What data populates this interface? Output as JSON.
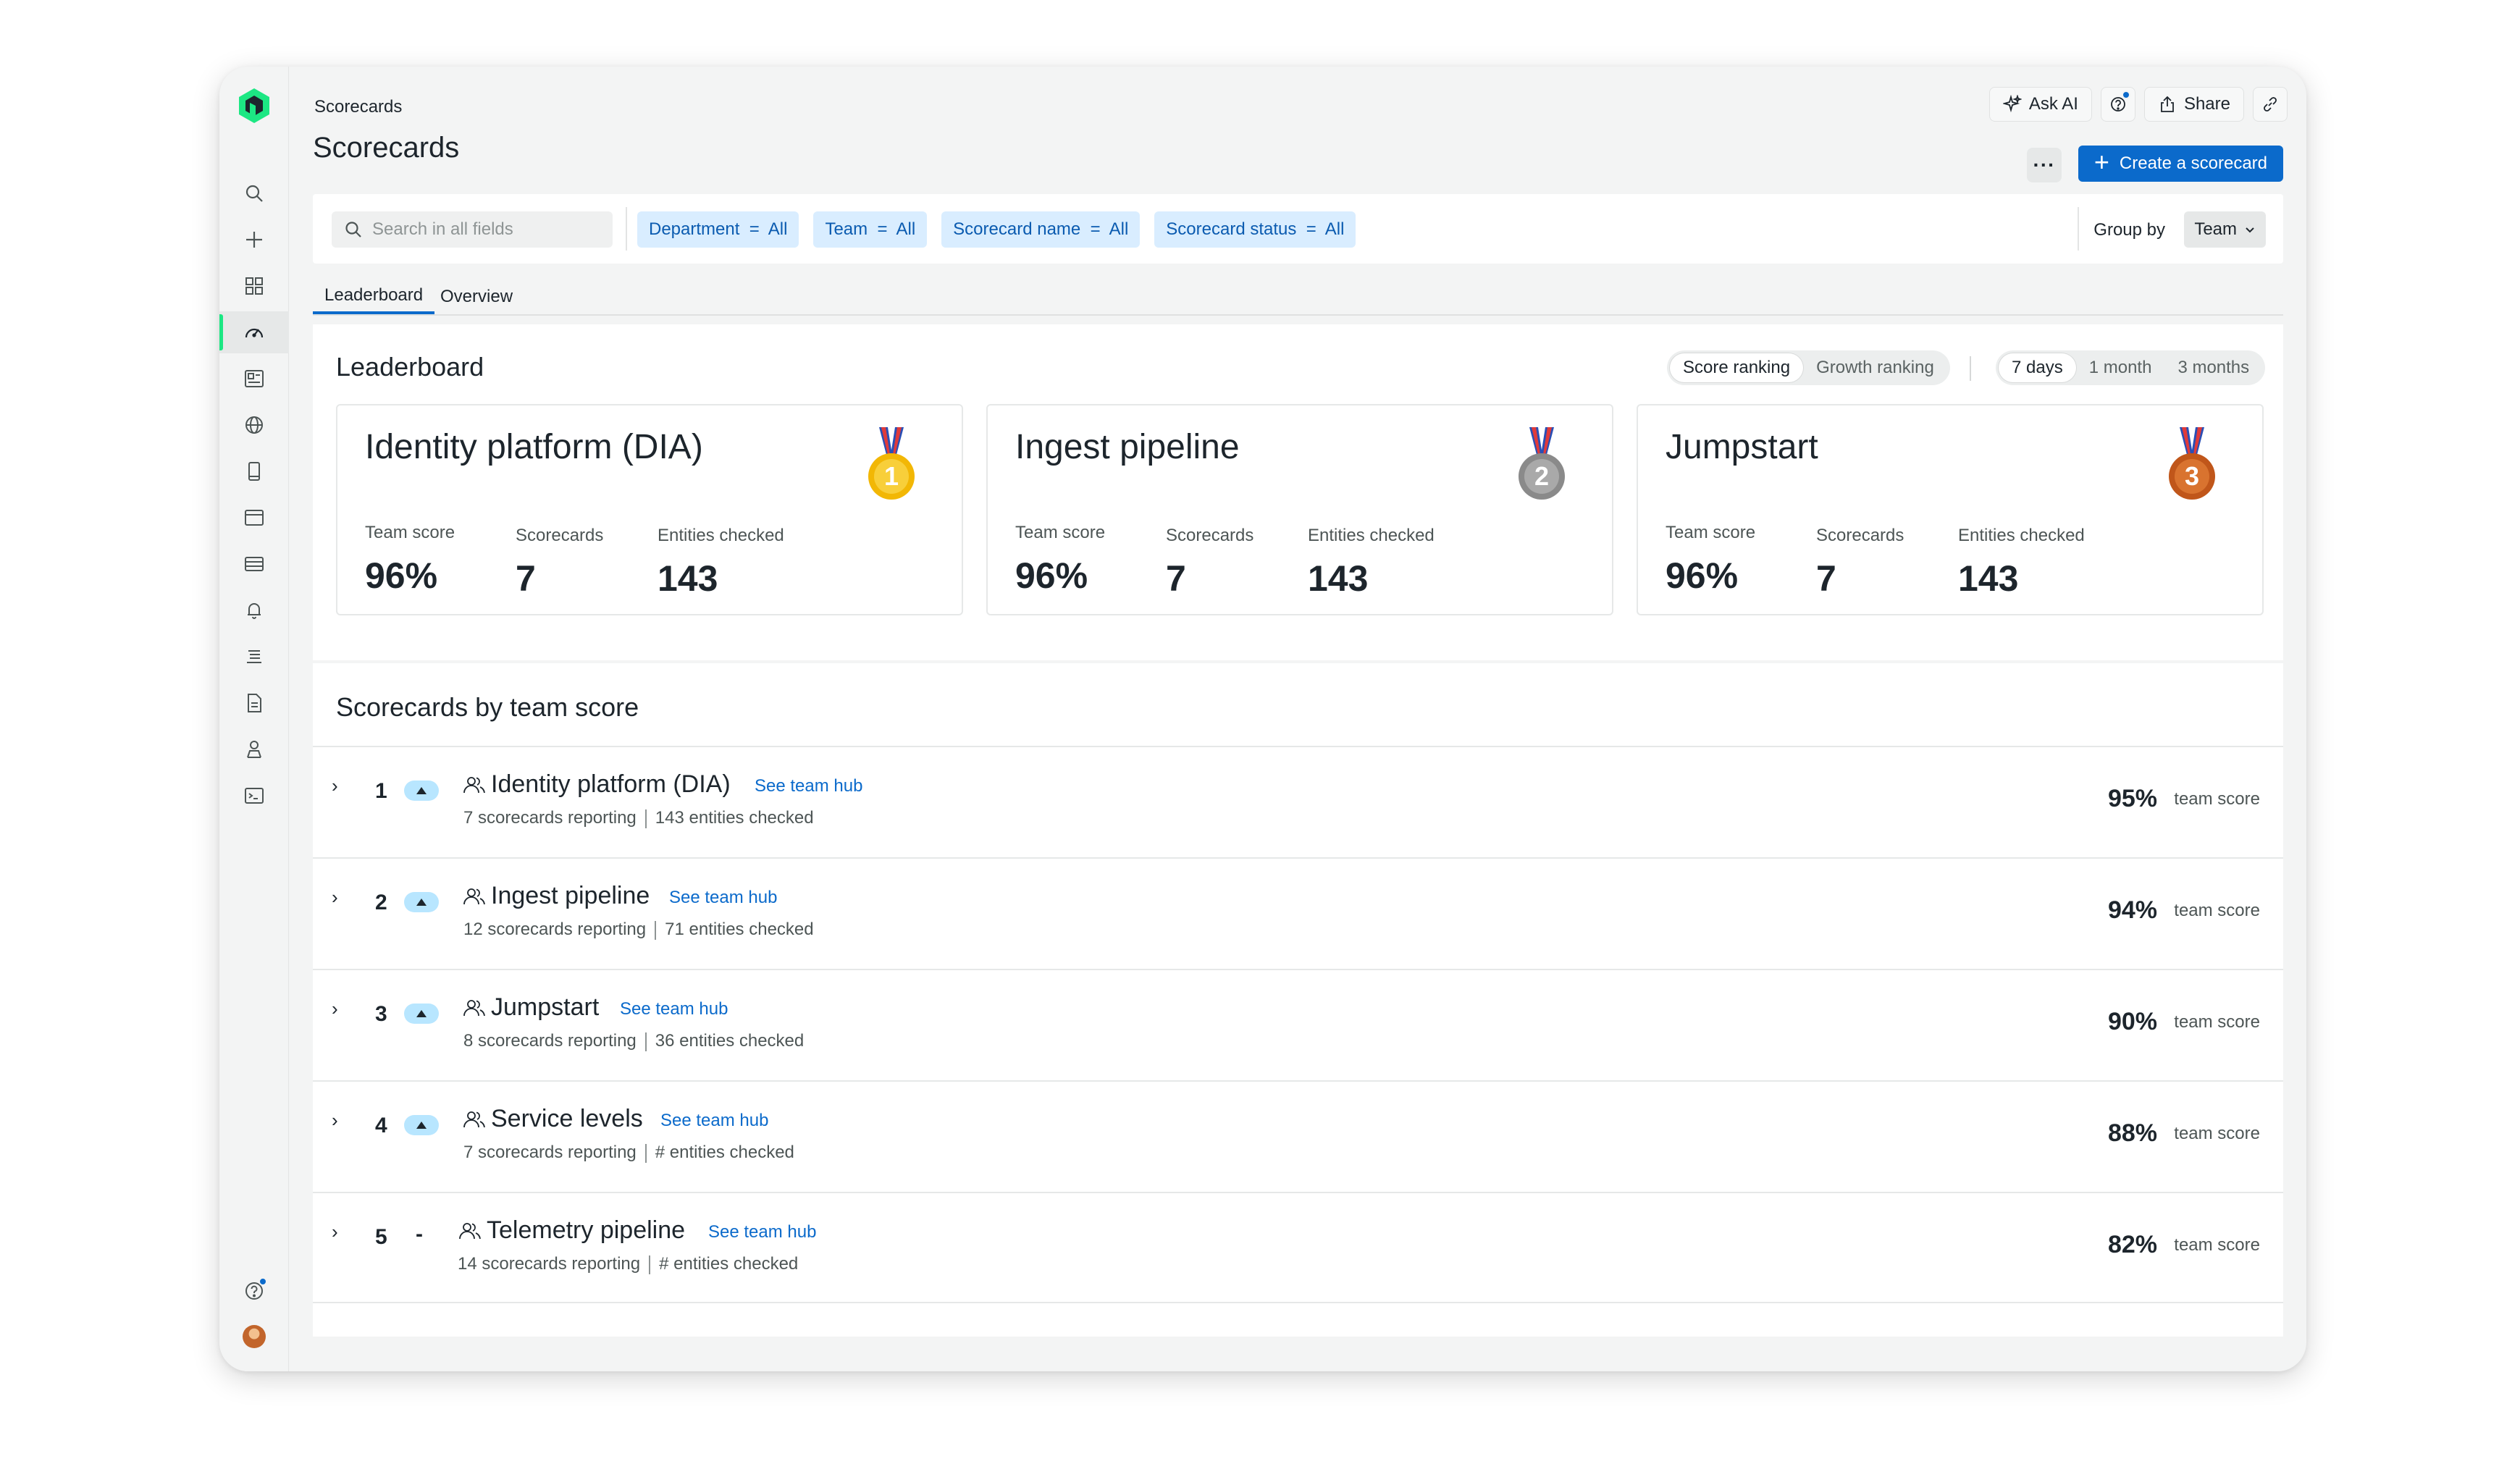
{
  "breadcrumb": "Scorecards",
  "page_title": "Scorecards",
  "top_actions": {
    "ask_ai": "Ask AI",
    "share": "Share"
  },
  "more_label": "···",
  "create_button": "Create a scorecard",
  "search": {
    "placeholder": "Search in all fields"
  },
  "filters": [
    "Department  =  All",
    "Team  =  All",
    "Scorecard name  =  All",
    "Scorecard status  =  All"
  ],
  "group_by": {
    "label": "Group by",
    "value": "Team"
  },
  "tabs": [
    "Leaderboard",
    "Overview"
  ],
  "leaderboard": {
    "title": "Leaderboard",
    "ranking_options": [
      "Score ranking",
      "Growth ranking"
    ],
    "period_options": [
      "7 days",
      "1 month",
      "3 months"
    ],
    "stat_labels": {
      "team_score": "Team score",
      "scorecards": "Scorecards",
      "entities": "Entities checked"
    },
    "cards": [
      {
        "name": "Identity platform (DIA)",
        "medal": "1",
        "team_score": "96%",
        "scorecards": "7",
        "entities": "143"
      },
      {
        "name": "Ingest pipeline",
        "medal": "2",
        "team_score": "96%",
        "scorecards": "7",
        "entities": "143"
      },
      {
        "name": "Jumpstart",
        "medal": "3",
        "team_score": "96%",
        "scorecards": "7",
        "entities": "143"
      }
    ]
  },
  "list": {
    "title": "Scorecards by team score",
    "hub_link": "See team hub",
    "score_label": "team score",
    "rows": [
      {
        "rank": "1",
        "trend": "up",
        "name": "Identity platform (DIA)",
        "reporting": "7 scorecards reporting",
        "entities": "143 entities checked",
        "score": "95%"
      },
      {
        "rank": "2",
        "trend": "up",
        "name": "Ingest pipeline",
        "reporting": "12 scorecards reporting",
        "entities": "71 entities checked",
        "score": "94%"
      },
      {
        "rank": "3",
        "trend": "up",
        "name": "Jumpstart",
        "reporting": "8 scorecards reporting",
        "entities": "36 entities checked",
        "score": "90%"
      },
      {
        "rank": "4",
        "trend": "up",
        "name": "Service levels",
        "reporting": "7 scorecards reporting",
        "entities": "# entities checked",
        "score": "88%"
      },
      {
        "rank": "5",
        "trend": "-",
        "name": "Telemetry pipeline",
        "reporting": "14 scorecards reporting",
        "entities": "# entities checked",
        "score": "82%"
      }
    ]
  },
  "colors": {
    "accent": "#0b6acb",
    "brand_green": "#1ce783",
    "chip_bg": "#d9edff",
    "trend_bg": "#b8e6ff",
    "gold": "#f2b705",
    "silver": "#9a9a9a",
    "bronze": "#c0561a"
  }
}
